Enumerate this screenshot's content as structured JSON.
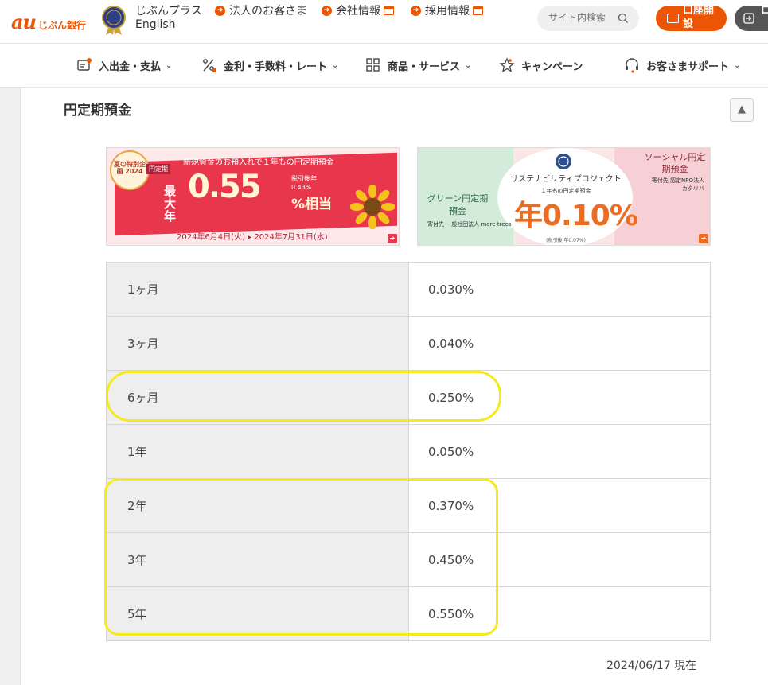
{
  "header": {
    "logo_au": "au",
    "logo_name": "じぶん銀行",
    "plus_link": "じぶんプラス",
    "english_link": "English",
    "links": [
      "法人のお客さま",
      "会社情報",
      "採用情報"
    ],
    "search_placeholder": "サイト内検索",
    "open_account_label": "口座開設",
    "login_label": "ロ",
    "accent_color": "#eb5505"
  },
  "nav": {
    "items": [
      {
        "label": "入出金・支払",
        "icon": "wallet-icon"
      },
      {
        "label": "金利・手数料・レート",
        "icon": "percent-icon"
      },
      {
        "label": "商品・サービス",
        "icon": "grid-icon"
      },
      {
        "label": "キャンペーン",
        "icon": "star-icon"
      },
      {
        "label": "お客さまサポート",
        "icon": "headset-icon"
      }
    ]
  },
  "page": {
    "title": "円定期預金",
    "scroll_top": "▲",
    "as_of": "2024/06/17 現在"
  },
  "banners": {
    "summer": {
      "badge": "夏の特別企画 2024",
      "tag": "円定期",
      "headline": "新規資金のお預入れで１年もの円定期預金",
      "max_label": "最大年",
      "rate": "0.55",
      "after_tax": "税引後年0.43%",
      "equiv": "%相当",
      "period": "2024年6月4日(火) ▸ 2024年7月31日(水)"
    },
    "sustainability": {
      "project": "サステナビリティプロジェクト",
      "sub": "１年もの円定期預金",
      "rate": "年0.10%",
      "after_tax": "(税引後 年0.07%)",
      "green_title": "グリーン円定期預金",
      "green_org": "寄付先 一般社団法人 more trees",
      "social_title": "ソーシャル円定期預金",
      "social_org": "寄付先 認定NPO法人 カタリバ"
    }
  },
  "rates": [
    {
      "term": "1ヶ月",
      "rate": "0.030%"
    },
    {
      "term": "3ヶ月",
      "rate": "0.040%"
    },
    {
      "term": "6ヶ月",
      "rate": "0.250%"
    },
    {
      "term": "1年",
      "rate": "0.050%"
    },
    {
      "term": "2年",
      "rate": "0.370%"
    },
    {
      "term": "3年",
      "rate": "0.450%"
    },
    {
      "term": "5年",
      "rate": "0.550%"
    }
  ]
}
